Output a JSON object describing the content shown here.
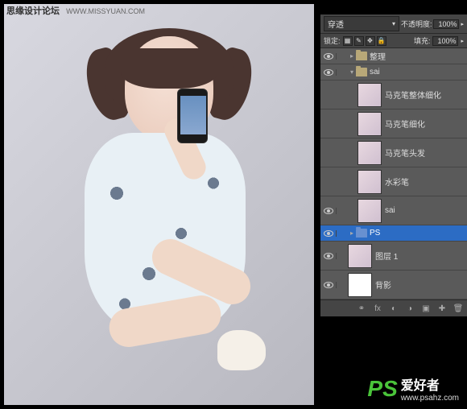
{
  "watermark_top": {
    "text": "思缘设计论坛",
    "url": "WWW.MISSYUAN.COM"
  },
  "panel": {
    "blend_mode": "穿透",
    "opacity_label": "不透明度:",
    "opacity_value": "100%",
    "lock_label": "锁定:",
    "fill_label": "填充:",
    "fill_value": "100%"
  },
  "layers": [
    {
      "type": "folder",
      "name": "整理",
      "visible": true,
      "expanded": false,
      "indent": 0
    },
    {
      "type": "folder",
      "name": "sai",
      "visible": true,
      "expanded": true,
      "indent": 0
    },
    {
      "type": "layer",
      "name": "马克笔整体细化",
      "visible": false,
      "indent": 1
    },
    {
      "type": "layer",
      "name": "马克笔细化",
      "visible": false,
      "indent": 1
    },
    {
      "type": "layer",
      "name": "马克笔头发",
      "visible": false,
      "indent": 1
    },
    {
      "type": "layer",
      "name": "水彩笔",
      "visible": false,
      "indent": 1
    },
    {
      "type": "layer",
      "name": "sai",
      "visible": true,
      "indent": 1
    },
    {
      "type": "folder",
      "name": "PS",
      "visible": true,
      "expanded": false,
      "indent": 0,
      "selected": true,
      "folderColor": "blue"
    },
    {
      "type": "layer",
      "name": "图层 1",
      "visible": true,
      "indent": 0
    },
    {
      "type": "layer",
      "name": "背影",
      "visible": true,
      "indent": 0,
      "blank": true
    }
  ],
  "watermark_bottom": {
    "logo": "PS",
    "text": "爱好者",
    "url": "www.psahz.com"
  }
}
